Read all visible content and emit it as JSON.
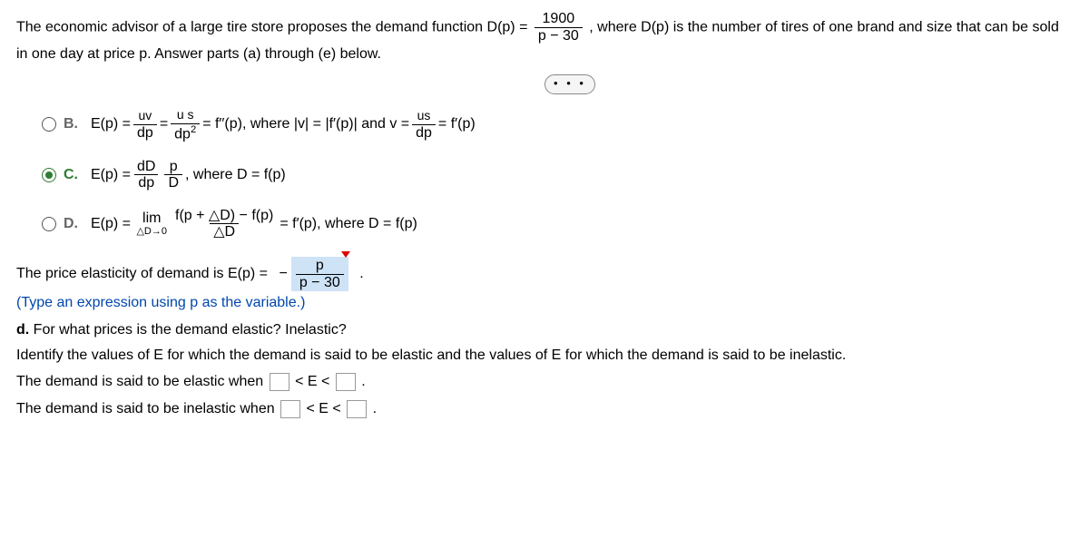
{
  "stem": {
    "part1": "The economic advisor of a large tire store proposes the demand function D(p) =",
    "frac_num": "1900",
    "frac_den": "p − 30",
    "part2": ", where D(p) is the number of tires of one brand and size that can be sold in one day at price p. Answer parts (a) through (e) below."
  },
  "dots_label": "• • •",
  "options": {
    "B": {
      "label": "B.",
      "pre": "E(p) =",
      "t1_top": "uv",
      "t1_bot": "dp",
      "eq1": "=",
      "t2_top": "u s",
      "t2_bot_left": "dp",
      "t2_bot_sup": "2",
      "eq2": "= f′′(p), where |v| = |f′(p)| and v =",
      "t3_top": "us",
      "t3_bot": "dp",
      "eq3": "= f′(p)"
    },
    "C": {
      "label": "C.",
      "pre": "E(p) =",
      "t1_top": "dD",
      "t1_bot": "dp",
      "t2_top": "p",
      "t2_bot": "D",
      "tail": ", where D = f(p)"
    },
    "D": {
      "label": "D.",
      "pre": "E(p) =",
      "lim": "lim",
      "lim_below": "△D→0",
      "num": "f(p + △D) − f(p)",
      "den": "△D",
      "tail": " = f′(p), where D = f(p)"
    }
  },
  "answer": {
    "lead": "The price elasticity of demand is E(p) =",
    "minus": "−",
    "frac_num": "p",
    "frac_den": "p − 30",
    "period": "."
  },
  "hint": "(Type an expression using p as the variable.)",
  "partD": {
    "label": "d.",
    "q": "For what prices is the demand elastic? Inelastic?",
    "instr": "Identify the values of E for which the demand is said to be elastic and the values of E for which the demand is said to be inelastic.",
    "elastic_pre": "The demand is said to be elastic when",
    "inelastic_pre": "The demand is said to be inelastic when",
    "lt": "< E <",
    "period": "."
  }
}
